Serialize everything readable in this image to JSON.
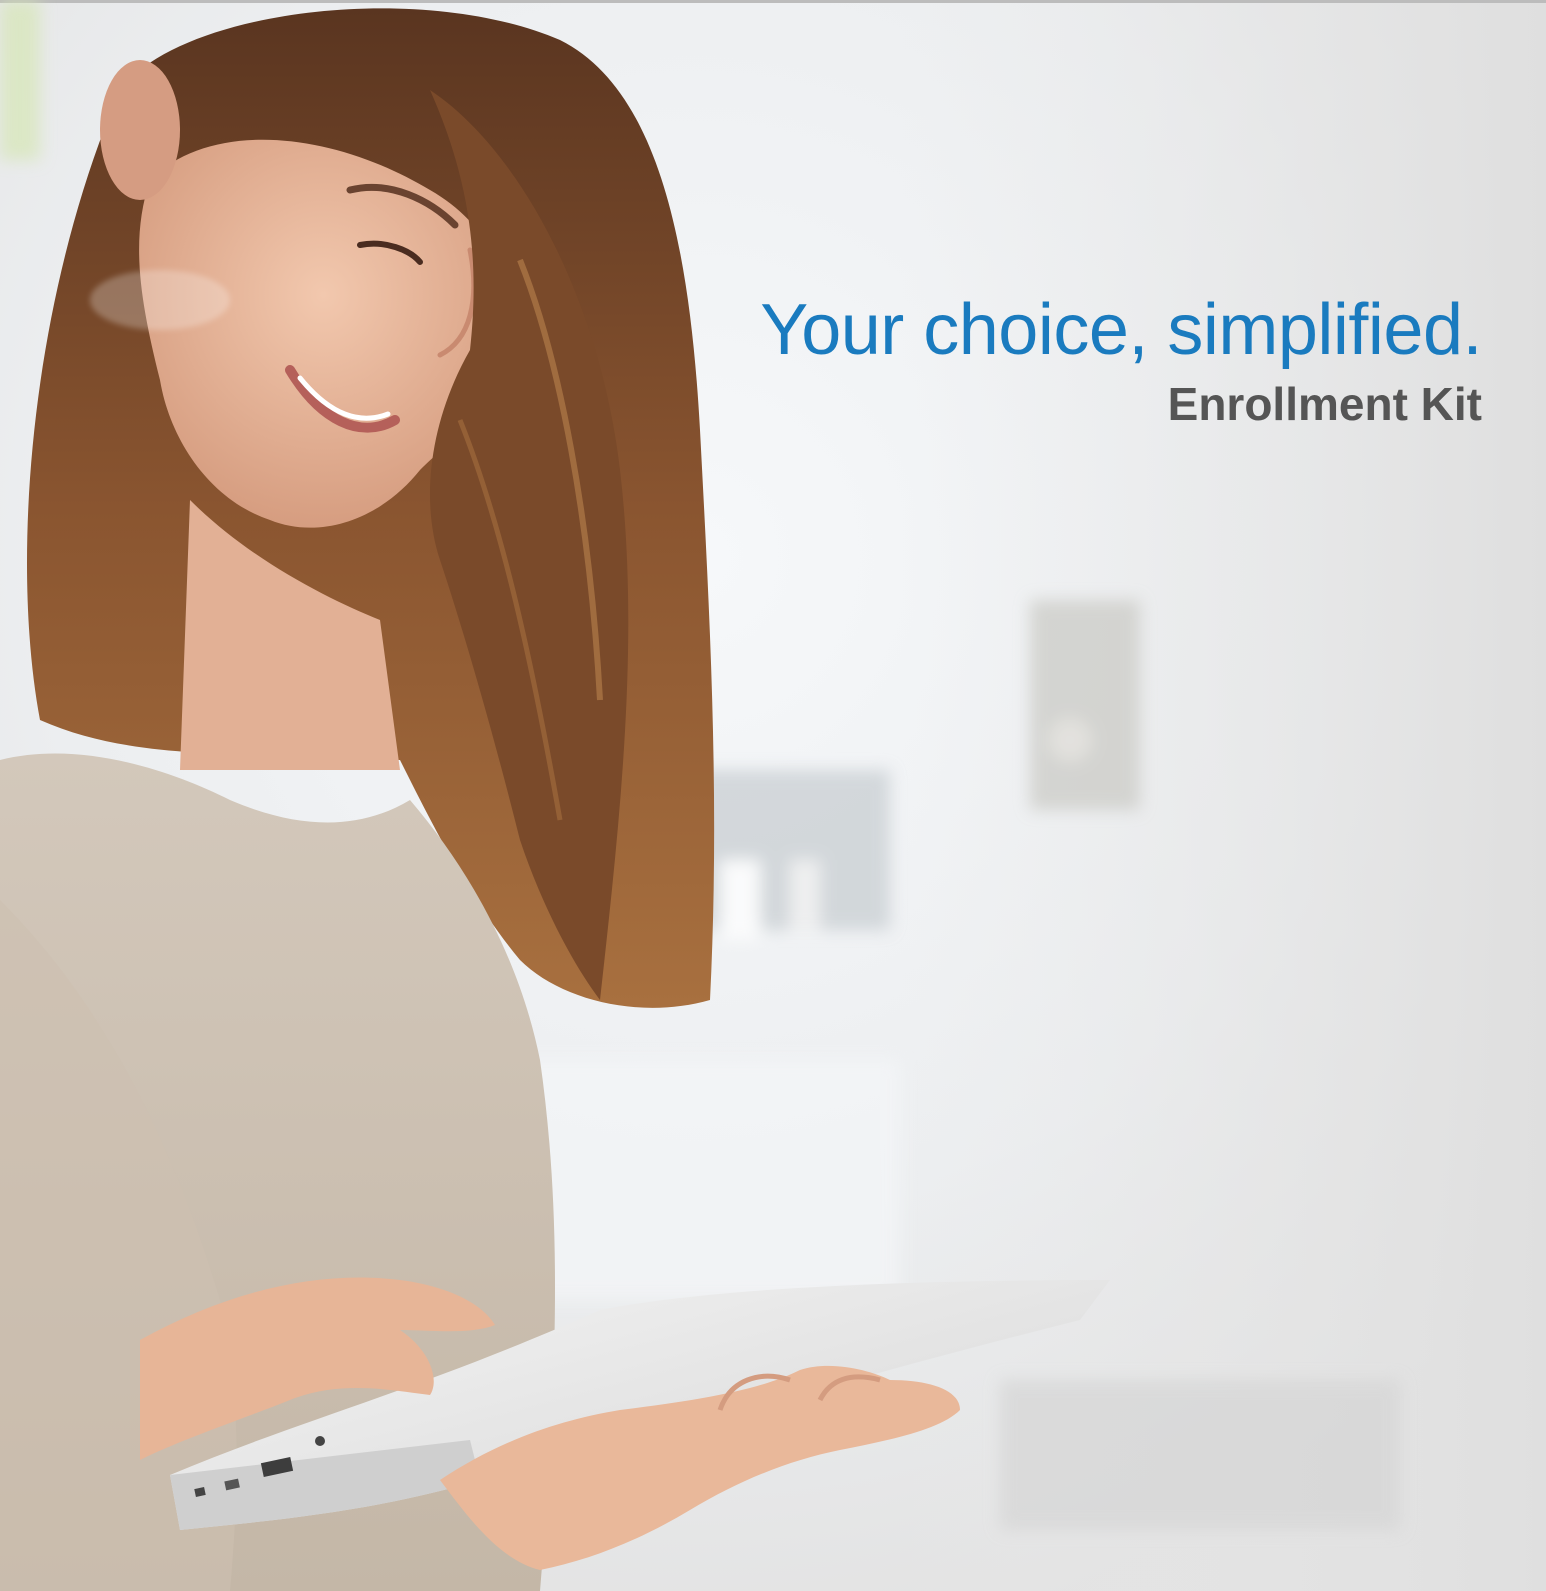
{
  "cover": {
    "tagline": "Your choice, simplified.",
    "title": "Enrollment Kit",
    "photo_description": "woman-using-tablet"
  },
  "colors": {
    "tagline": "#1a7bbf",
    "title": "#555555",
    "background": "#e4e4e4"
  }
}
